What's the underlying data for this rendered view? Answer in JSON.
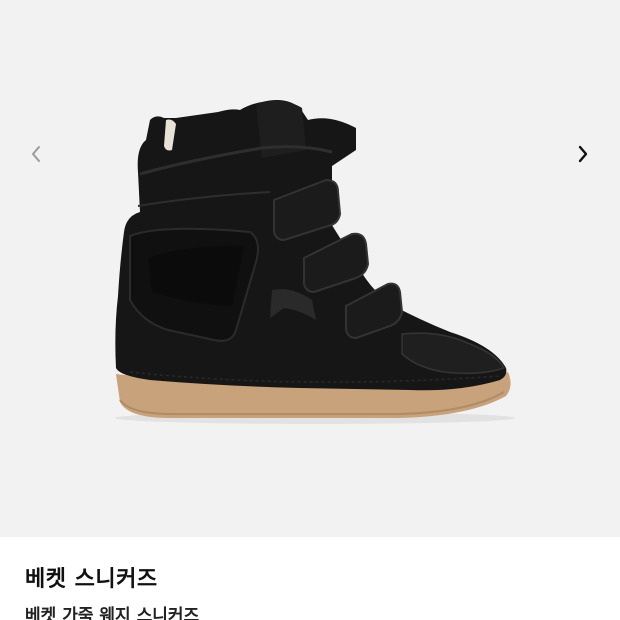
{
  "gallery": {
    "image_alt": "black suede wedge sneaker",
    "prev_icon": "chevron-left-icon",
    "next_icon": "chevron-right-icon",
    "prev_color": "#9a9a9a",
    "next_color": "#111111",
    "background": "#f2f2f2"
  },
  "product": {
    "title": "베켓 스니커즈",
    "subtitle": "베켓 가죽 웨지 스니커즈"
  }
}
